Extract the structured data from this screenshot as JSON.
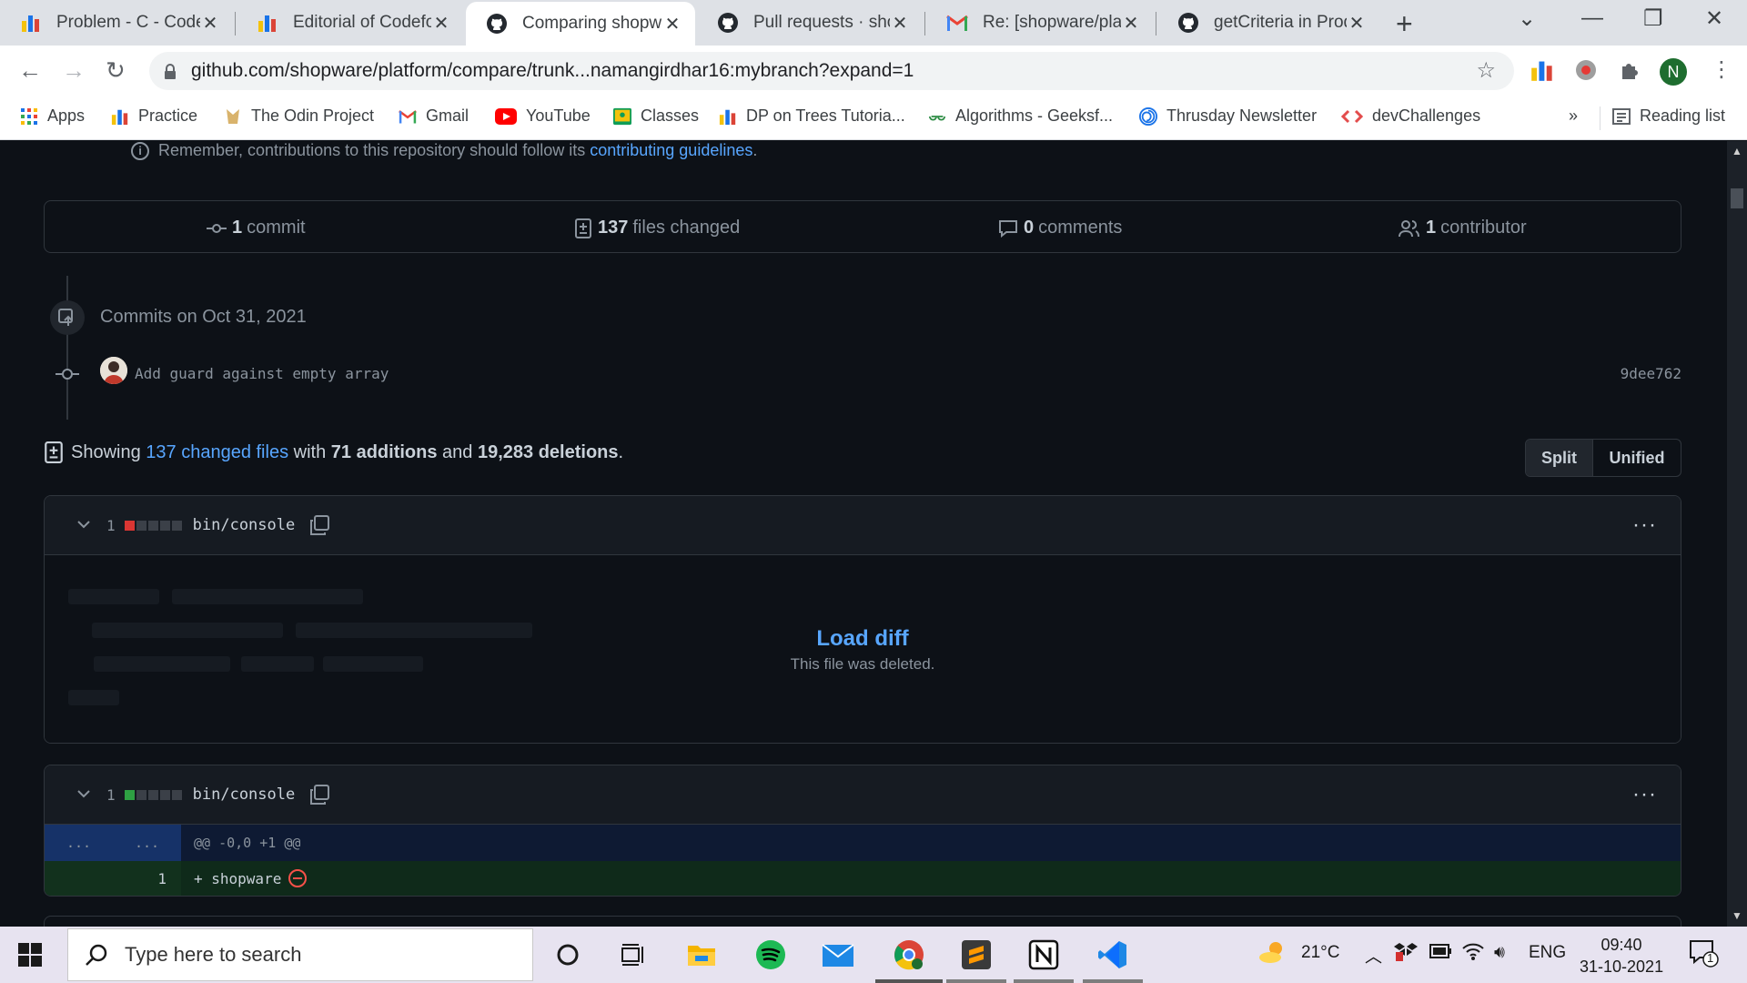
{
  "browser": {
    "tabs": [
      {
        "title": "Problem - C - Codeforces",
        "icon": "codeforces-icon"
      },
      {
        "title": "Editorial of Codeforces",
        "icon": "codeforces-icon"
      },
      {
        "title": "Comparing shopware",
        "icon": "github-icon",
        "active": true
      },
      {
        "title": "Pull requests · shopware",
        "icon": "github-icon"
      },
      {
        "title": "Re: [shopware/platform]",
        "icon": "gmail-icon"
      },
      {
        "title": "getCriteria in Product",
        "icon": "github-icon"
      }
    ],
    "url": "github.com/shopware/platform/compare/trunk...namangirdhar16:mybranch?expand=1",
    "profile_initial": "N",
    "bookmarks": [
      {
        "label": "Apps",
        "icon": "apps-grid-icon"
      },
      {
        "label": "Practice",
        "icon": "codeforces-icon"
      },
      {
        "label": "The Odin Project",
        "icon": "odin-icon"
      },
      {
        "label": "Gmail",
        "icon": "gmail-icon"
      },
      {
        "label": "YouTube",
        "icon": "youtube-icon"
      },
      {
        "label": "Classes",
        "icon": "classroom-icon"
      },
      {
        "label": "DP on Trees Tutoria...",
        "icon": "codeforces-icon"
      },
      {
        "label": "Algorithms - Geeksf...",
        "icon": "geeksforgeeks-icon"
      },
      {
        "label": "Thrusday Newsletter",
        "icon": "newsletter-icon"
      },
      {
        "label": "devChallenges",
        "icon": "devchallenges-icon"
      }
    ],
    "bookmarks_overflow": "»",
    "reading_list": "Reading list"
  },
  "page": {
    "remember_prefix": "Remember, contributions to this repository should follow its",
    "remember_link": "contributing guidelines",
    "remember_suffix": ".",
    "stats": {
      "commits_count": "1",
      "commits_label": "commit",
      "files_count": "137",
      "files_label": "files changed",
      "comments_count": "0",
      "comments_label": "comments",
      "contributors_count": "1",
      "contributors_label": "contributor"
    },
    "commits_date": "Commits on Oct 31, 2021",
    "commit": {
      "message": "Add guard against empty array",
      "sha": "9dee762"
    },
    "summary": {
      "showing": "Showing",
      "files_link": "137 changed files",
      "with": "with",
      "additions": "71 additions",
      "and": "and",
      "deletions": "19,283 deletions",
      "end": "."
    },
    "view_toggle": {
      "split": "Split",
      "unified": "Unified"
    },
    "files": [
      {
        "count": "1",
        "name": "bin/console",
        "status": "deleted",
        "load_diff": "Load diff",
        "note": "This file was deleted."
      },
      {
        "count": "1",
        "name": "bin/console",
        "status": "added",
        "hunk_left": "...",
        "hunk_right": "...",
        "hunk_header": "@@ -0,0 +1 @@",
        "line_number": "1",
        "line_code": "+ shopware"
      }
    ],
    "colors": {
      "deletion": "#da3633",
      "addition": "#2ea043",
      "link": "#58a6ff"
    }
  },
  "taskbar": {
    "search_placeholder": "Type here to search",
    "weather": "21°C",
    "language": "ENG",
    "time": "09:40",
    "date": "31-10-2021",
    "notification_count": "1"
  }
}
